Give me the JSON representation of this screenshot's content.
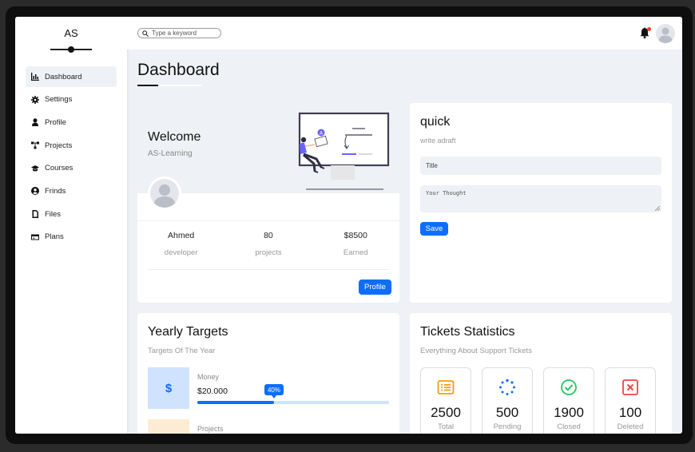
{
  "brand": {
    "name": "AS"
  },
  "sidebar": {
    "items": [
      {
        "label": "Dashboard",
        "icon": "chart-icon",
        "active": true
      },
      {
        "label": "Settings",
        "icon": "gear-icon",
        "active": false
      },
      {
        "label": "Profile",
        "icon": "user-icon",
        "active": false
      },
      {
        "label": "Projects",
        "icon": "diagram-icon",
        "active": false
      },
      {
        "label": "Courses",
        "icon": "graduation-cap-icon",
        "active": false
      },
      {
        "label": "Frinds",
        "icon": "user-circle-icon",
        "active": false
      },
      {
        "label": "Files",
        "icon": "file-icon",
        "active": false
      },
      {
        "label": "Plans",
        "icon": "credit-card-icon",
        "active": false
      }
    ]
  },
  "topbar": {
    "search": {
      "placeholder": "Type a keyword",
      "value": ""
    },
    "icons": [
      "search-icon",
      "bell-icon",
      "avatar"
    ]
  },
  "page": {
    "title": "Dashboard"
  },
  "welcome": {
    "title": "Welcome",
    "subtitle": "AS-Learning",
    "stats": [
      {
        "value": "Ahmed",
        "label": "developer"
      },
      {
        "value": "80",
        "label": "projects"
      },
      {
        "value": "$8500",
        "label": "Earned"
      }
    ],
    "profile_button": "Profile"
  },
  "quick": {
    "title": "quick",
    "subtitle": "write adraft",
    "title_placeholder": "Title",
    "thought_placeholder": "Your Thought",
    "save_button": "Save"
  },
  "targets": {
    "title": "Yearly Targets",
    "subtitle": "Targets Of The Year",
    "items": [
      {
        "icon": "$",
        "label": "Money",
        "value": "$20.000",
        "progress": 0.4,
        "progress_label": "40%",
        "color": "#0d6efd"
      },
      {
        "icon": "",
        "label": "Projects",
        "value": "",
        "color": "#fdecd3"
      }
    ]
  },
  "tickets": {
    "title": "Tickets Statistics",
    "subtitle": "Everything About Support Tickets",
    "items": [
      {
        "value": "2500",
        "label": "Total",
        "icon": "list-icon",
        "color": "#f59e0b"
      },
      {
        "value": "500",
        "label": "Pending",
        "icon": "spinner-icon",
        "color": "#0d6efd"
      },
      {
        "value": "1900",
        "label": "Closed",
        "icon": "check-circle-icon",
        "color": "#22c55e"
      },
      {
        "value": "100",
        "label": "Deleted",
        "icon": "x-square-icon",
        "color": "#ef4444"
      }
    ]
  },
  "colors": {
    "primary": "#0d6efd",
    "background": "#eef1f5",
    "notification": "#f44336"
  }
}
